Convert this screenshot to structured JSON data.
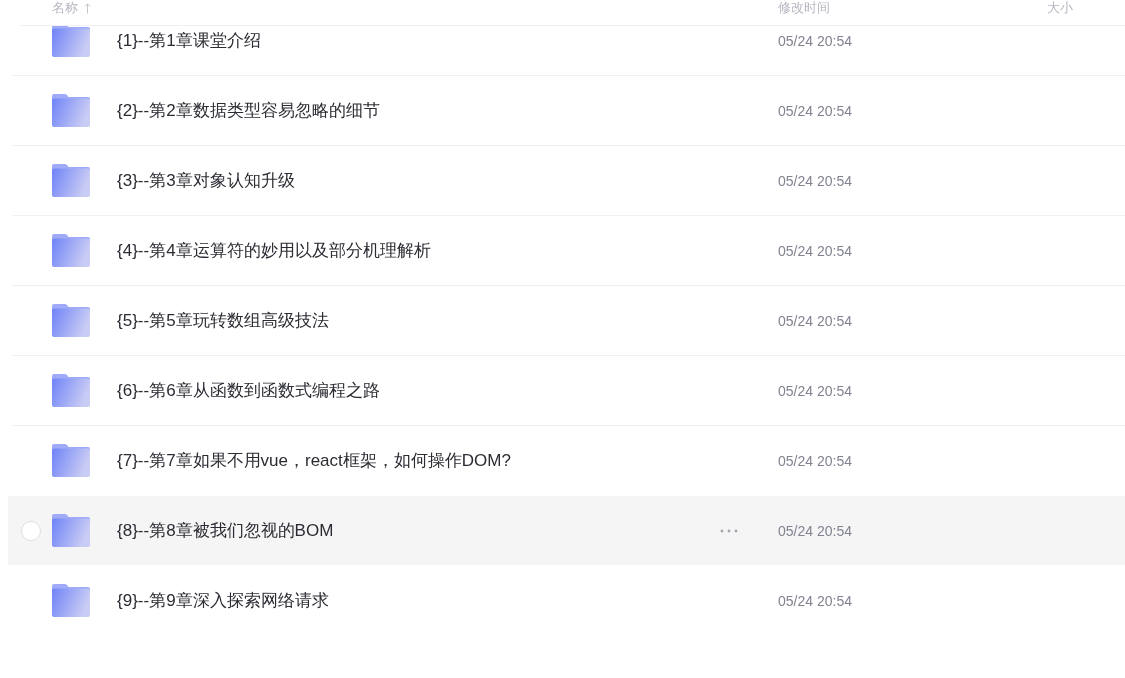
{
  "header": {
    "columns": [
      {
        "label": "名称",
        "sorted": true
      },
      {
        "label": "修改时间",
        "sorted": false
      },
      {
        "label": "大小",
        "sorted": false
      }
    ]
  },
  "files": [
    {
      "name": "{1}--第1章课堂介绍",
      "modified": "05/24 20:54",
      "hovered": false,
      "checked": false
    },
    {
      "name": "{2}--第2章数据类型容易忽略的细节",
      "modified": "05/24 20:54",
      "hovered": false,
      "checked": false
    },
    {
      "name": "{3}--第3章对象认知升级",
      "modified": "05/24 20:54",
      "hovered": false,
      "checked": false
    },
    {
      "name": "{4}--第4章运算符的妙用以及部分机理解析",
      "modified": "05/24 20:54",
      "hovered": false,
      "checked": false
    },
    {
      "name": "{5}--第5章玩转数组高级技法",
      "modified": "05/24 20:54",
      "hovered": false,
      "checked": false
    },
    {
      "name": "{6}--第6章从函数到函数式编程之路",
      "modified": "05/24 20:54",
      "hovered": false,
      "checked": false
    },
    {
      "name": "{7}--第7章如果不用vue，react框架，如何操作DOM?",
      "modified": "05/24 20:54",
      "hovered": false,
      "checked": false
    },
    {
      "name": "{8}--第8章被我们忽视的BOM",
      "modified": "05/24 20:54",
      "hovered": true,
      "checked": false
    },
    {
      "name": "{9}--第9章深入探索网络请求",
      "modified": "05/24 20:54",
      "hovered": false,
      "checked": false
    }
  ]
}
